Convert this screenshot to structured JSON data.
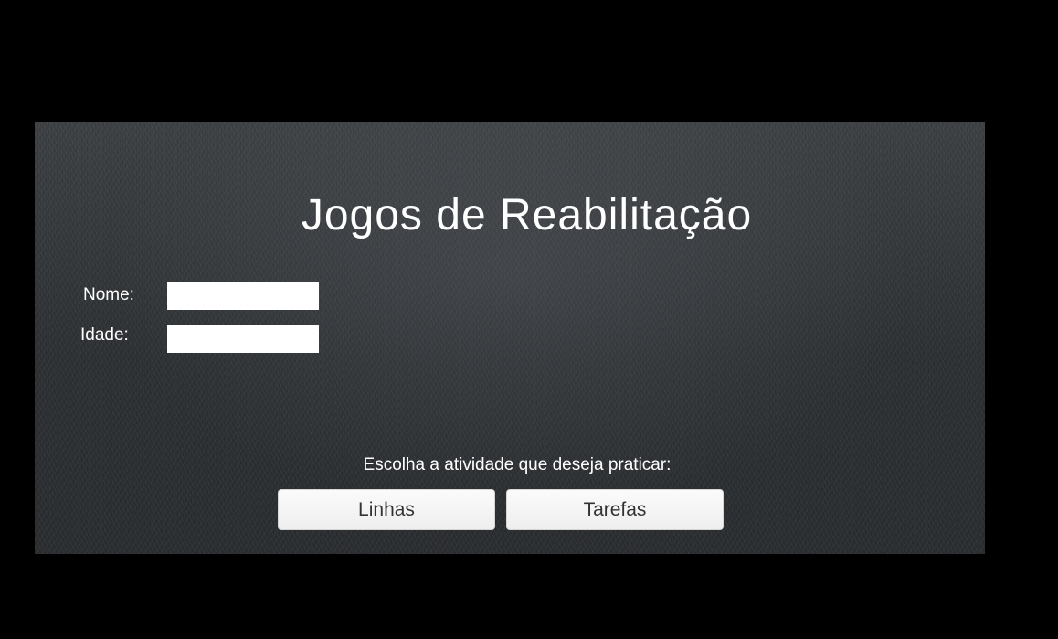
{
  "app": {
    "title": "Jogos de Reabilitação"
  },
  "form": {
    "name_label": "Nome:",
    "name_value": "",
    "age_label": "Idade:",
    "age_value": ""
  },
  "activities": {
    "prompt": "Escolha a atividade que deseja praticar:",
    "buttons": [
      {
        "label": "Linhas"
      },
      {
        "label": "Tarefas"
      }
    ]
  },
  "colors": {
    "page_background": "#000000",
    "panel_background": "#2f3235",
    "text": "#ffffff",
    "input_background": "#ffffff",
    "button_background": "#f4f4f4",
    "button_text": "#333333"
  }
}
